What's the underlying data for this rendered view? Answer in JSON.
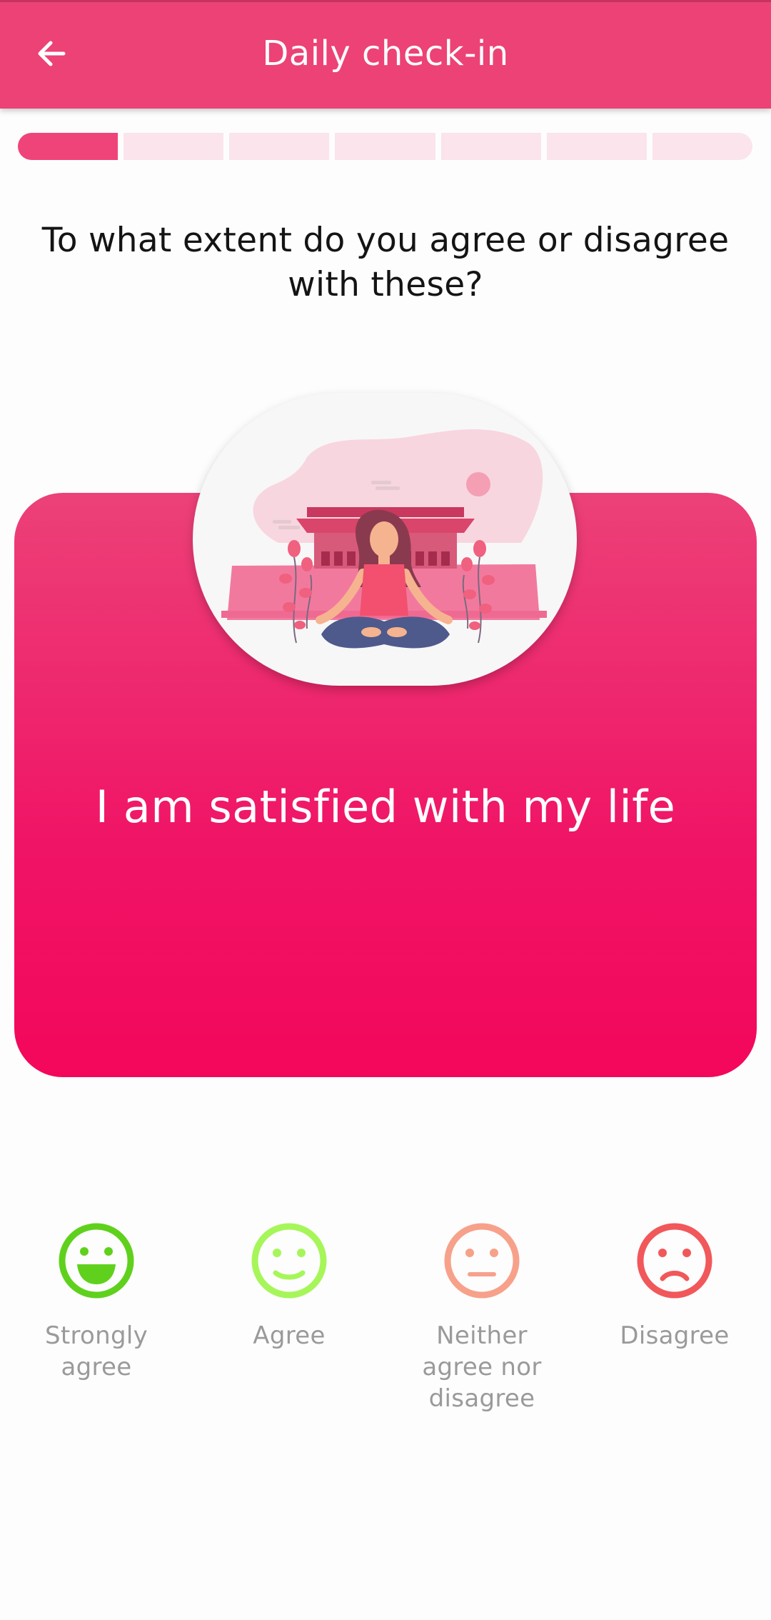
{
  "header": {
    "title": "Daily check-in",
    "back_icon": "arrow-left-icon"
  },
  "progress": {
    "total_steps": 7,
    "current_step": 1,
    "active_color": "#ef4479",
    "inactive_color": "#fbe4ec"
  },
  "question": "To what extent do you agree or disagree with these?",
  "card": {
    "statement": "I am satisfied with my life",
    "illustration": "meditating-woman-illustration",
    "gradient_top": "#ec4178",
    "gradient_bottom": "#f3075b"
  },
  "options": [
    {
      "label": "Strongly agree",
      "icon": "big-smile-icon",
      "color": "#5fd11d"
    },
    {
      "label": "Agree",
      "icon": "smile-icon",
      "color": "#a6f65a"
    },
    {
      "label": "Neither agree nor disagree",
      "icon": "neutral-face-icon",
      "color": "#f7a18a"
    },
    {
      "label": "Disagree",
      "icon": "frown-icon",
      "color": "#f1585a"
    }
  ]
}
